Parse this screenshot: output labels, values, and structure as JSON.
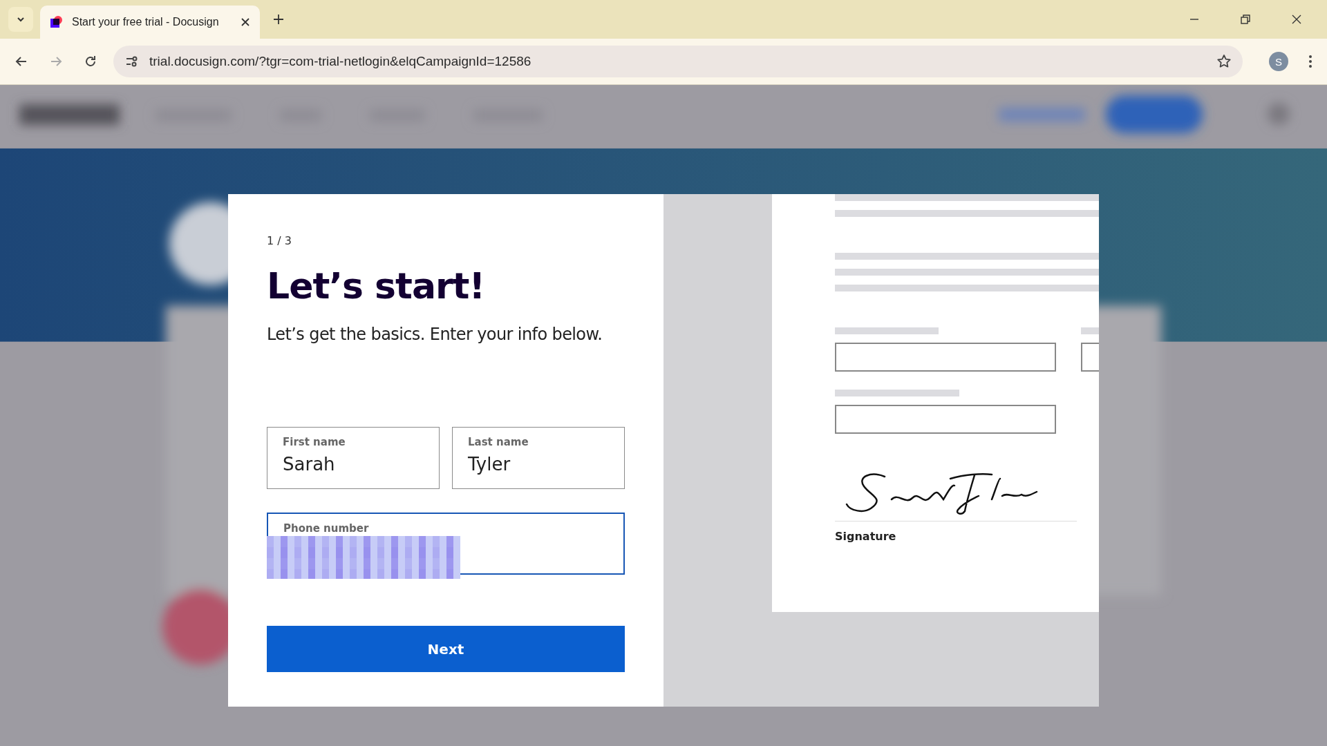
{
  "browser": {
    "tab": {
      "title": "Start your free trial - Docusign",
      "selected": true
    },
    "address": "trial.docusign.com/?tgr=com-trial-netlogin&elqCampaignId=12586",
    "profile_initial": "S"
  },
  "modal": {
    "step": "1 / 3",
    "title": "Let’s start!",
    "subtitle": "Let’s get the basics. Enter your info below.",
    "fields": [
      {
        "label": "First name",
        "value": "Sarah",
        "focused": false,
        "redacted": false
      },
      {
        "label": "Last name",
        "value": "Tyler",
        "focused": false,
        "redacted": false
      },
      {
        "label": "Phone number",
        "focused": true,
        "redacted": true
      }
    ],
    "button": "Next",
    "preview": {
      "signature_label": "Signature"
    }
  }
}
